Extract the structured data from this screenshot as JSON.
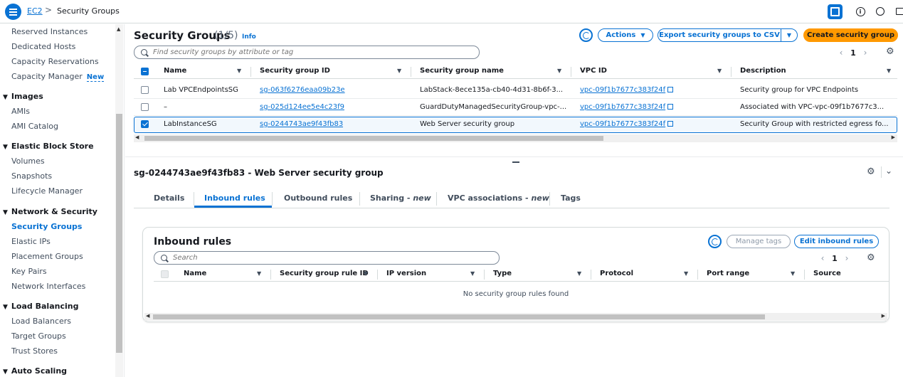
{
  "topbar": {
    "breadcrumb": [
      "EC2",
      "Security Groups"
    ],
    "separator": ">",
    "icons": [
      "menu-icon",
      "side-panel-icon",
      "info-icon",
      "tour-icon",
      "feedback-icon"
    ]
  },
  "sidebar": {
    "items": [
      {
        "label": "Reserved Instances",
        "type": "item"
      },
      {
        "label": "Dedicated Hosts",
        "type": "item"
      },
      {
        "label": "Capacity Reservations",
        "type": "item"
      },
      {
        "label": "Capacity Manager",
        "type": "item",
        "badge": "New"
      },
      {
        "label": "Images",
        "type": "section"
      },
      {
        "label": "AMIs",
        "type": "item"
      },
      {
        "label": "AMI Catalog",
        "type": "item"
      },
      {
        "label": "Elastic Block Store",
        "type": "section"
      },
      {
        "label": "Volumes",
        "type": "item"
      },
      {
        "label": "Snapshots",
        "type": "item"
      },
      {
        "label": "Lifecycle Manager",
        "type": "item"
      },
      {
        "label": "Network & Security",
        "type": "section"
      },
      {
        "label": "Security Groups",
        "type": "item",
        "active": true
      },
      {
        "label": "Elastic IPs",
        "type": "item"
      },
      {
        "label": "Placement Groups",
        "type": "item"
      },
      {
        "label": "Key Pairs",
        "type": "item"
      },
      {
        "label": "Network Interfaces",
        "type": "item"
      },
      {
        "label": "Load Balancing",
        "type": "section"
      },
      {
        "label": "Load Balancers",
        "type": "item"
      },
      {
        "label": "Target Groups",
        "type": "item"
      },
      {
        "label": "Trust Stores",
        "type": "item"
      },
      {
        "label": "Auto Scaling",
        "type": "section"
      }
    ]
  },
  "list": {
    "title": "Security Groups",
    "count": "(1/5)",
    "info": "Info",
    "actions_label": "Actions",
    "export_label": "Export security groups to CSV",
    "create_label": "Create security group",
    "search_placeholder": "Find security groups by attribute or tag",
    "page": "1",
    "columns": [
      "Name",
      "Security group ID",
      "Security group name",
      "VPC ID",
      "Description"
    ],
    "rows": [
      {
        "name": "Lab VPCEndpointsSG",
        "id": "sg-063f6276eaa09b23e",
        "group_name": "LabStack-8ece135a-cb40-4d31-8b6f-3...",
        "vpc": "vpc-09f1b7677c383f24f",
        "description": "Security group for VPC Endpoints",
        "selected": false
      },
      {
        "name": "–",
        "id": "sg-025d124ee5e4c23f9",
        "group_name": "GuardDutyManagedSecurityGroup-vpc-...",
        "vpc": "vpc-09f1b7677c383f24f",
        "description": "Associated with VPC-vpc-09f1b7677c3...",
        "selected": false
      },
      {
        "name": "LabInstanceSG",
        "id": "sg-0244743ae9f43fb83",
        "group_name": "Web Server security group",
        "vpc": "vpc-09f1b7677c383f24f",
        "description": "Security Group with restricted egress fo...",
        "selected": true
      }
    ]
  },
  "detail": {
    "title": "sg-0244743ae9f43fb83 - Web Server security group",
    "tabs": [
      {
        "label": "Details"
      },
      {
        "label": "Inbound rules",
        "active": true
      },
      {
        "label": "Outbound rules"
      },
      {
        "label": "Sharing - ",
        "em": "new"
      },
      {
        "label": "VPC associations - ",
        "em": "new"
      },
      {
        "label": "Tags"
      }
    ]
  },
  "inbound": {
    "title": "Inbound rules",
    "manage_tags_label": "Manage tags",
    "edit_label": "Edit inbound rules",
    "search_placeholder": "Search",
    "page": "1",
    "columns": [
      "Name",
      "Security group rule ID",
      "IP version",
      "Type",
      "Protocol",
      "Port range",
      "Source"
    ],
    "empty_message": "No security group rules found"
  },
  "colors": {
    "accent": "#0972d3",
    "primary_button": "#ff9900",
    "text": "#16191f"
  }
}
